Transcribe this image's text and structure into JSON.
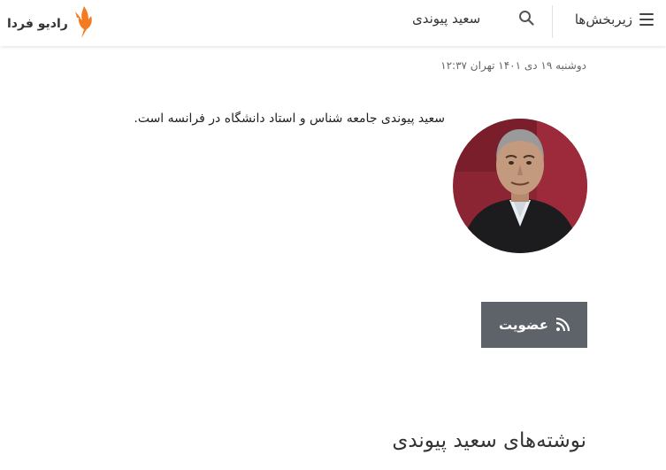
{
  "header": {
    "menu_label": "زیربخش‌ها",
    "title": "سعید پیوندی",
    "logo_text": "رادیو فردا",
    "logo_color": "#f47b20"
  },
  "profile": {
    "date": "دوشنبه ۱۹ دی ۱۴۰۱ تهران ۱۲:۳۷",
    "bio": "سعید پیوندی جامعه شناس و استاد دانشگاه در فرانسه است.",
    "subscribe_label": "عضویت"
  },
  "articles": {
    "section_title": "نوشته‌های سعید پیوندی"
  },
  "colors": {
    "subscribe_bg": "#5e6369",
    "accent": "#f47b20"
  },
  "icons": {
    "menu": "hamburger-icon",
    "search": "search-icon",
    "subscribe": "rss-icon"
  }
}
